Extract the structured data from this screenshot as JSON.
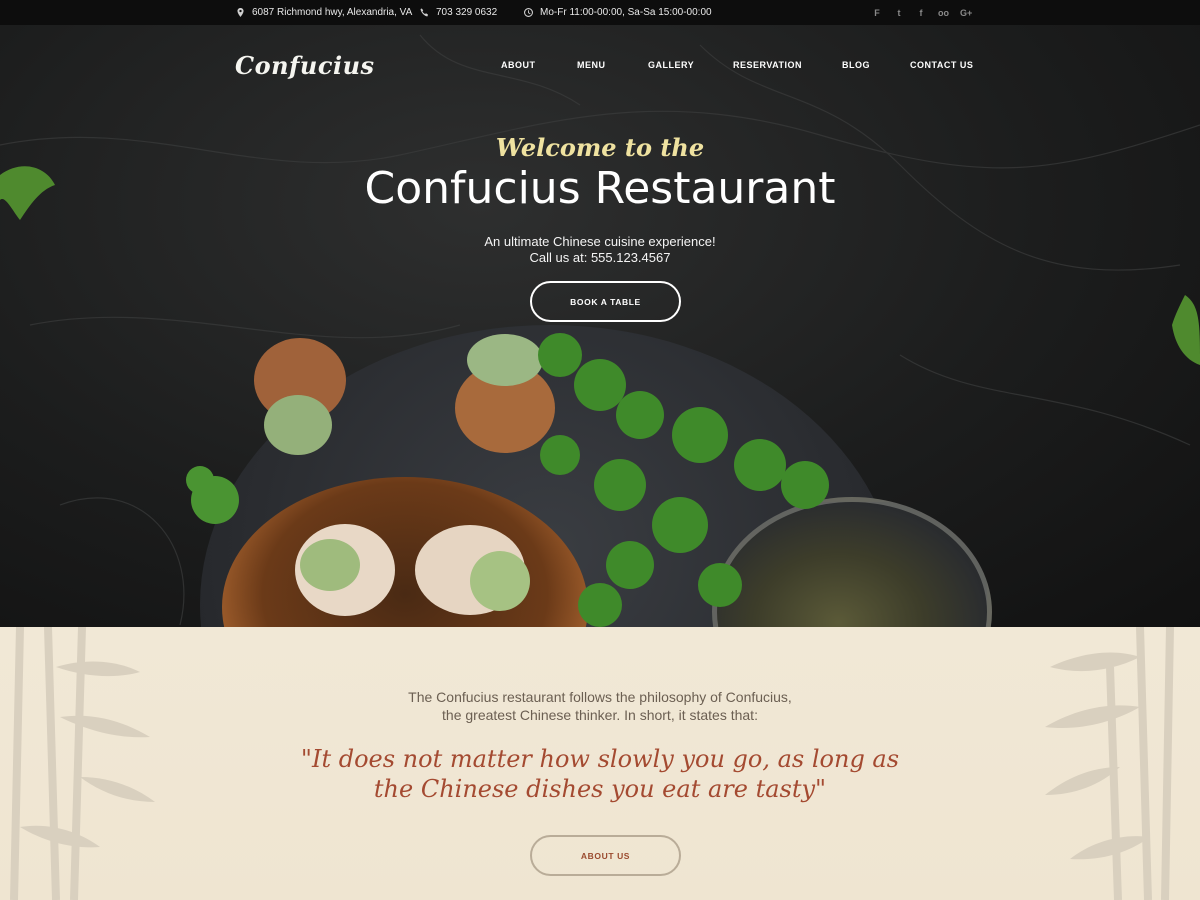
{
  "topbar": {
    "address": "6087 Richmond hwy, Alexandria, VA",
    "phone": "703 329 0632",
    "hours": "Mo-Fr 11:00-00:00, Sa-Sa 15:00-00:00",
    "socials": [
      {
        "icon": "foursquare-icon",
        "glyph": "F"
      },
      {
        "icon": "twitter-icon",
        "glyph": "t"
      },
      {
        "icon": "facebook-icon",
        "glyph": "f"
      },
      {
        "icon": "tripadvisor-icon",
        "glyph": "oo"
      },
      {
        "icon": "google-plus-icon",
        "glyph": "G+"
      }
    ]
  },
  "header": {
    "logo": "Confucius",
    "nav": [
      "ABOUT",
      "MENU",
      "GALLERY",
      "RESERVATION",
      "BLOG",
      "CONTACT US"
    ]
  },
  "hero": {
    "welcome": "Welcome to the",
    "title": "Confucius Restaurant",
    "subtitle_line1": "An ultimate Chinese cuisine experience!",
    "subtitle_line2": "Call us at: 555.123.4567",
    "cta": "BOOK A TABLE"
  },
  "about": {
    "intro_line1": "The Confucius restaurant follows the philosophy of Confucius,",
    "intro_line2": "the greatest Chinese thinker. In short, it states that:",
    "quote_line1": "\"It does not matter how slowly you go, as long as",
    "quote_line2": "the Chinese dishes you eat are tasty\"",
    "cta": "ABOUT US"
  },
  "colors": {
    "topbar_bg": "#0d0d0d",
    "hero_bg": "#1c1d1d",
    "welcome_accent": "#efe2a0",
    "about_bg": "#f1e8d6",
    "quote_accent": "#a44a31"
  }
}
